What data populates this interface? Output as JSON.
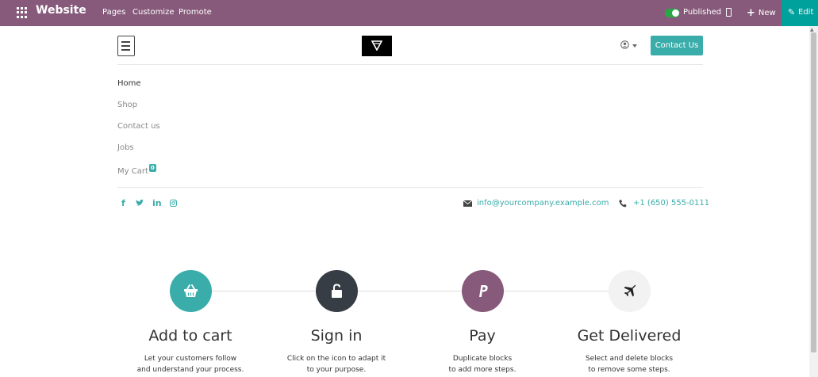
{
  "topbar": {
    "app_name": "Website",
    "menu": [
      "Pages",
      "Customize",
      "Promote"
    ],
    "published_label": "Published",
    "new_label": "New",
    "edit_label": "Edit",
    "color": "#875a7b",
    "edit_color": "#00a09d"
  },
  "header": {
    "contact_button": "Contact Us",
    "accent": "#3aadaa"
  },
  "nav": {
    "items": [
      "Home",
      "Shop",
      "Contact us",
      "Jobs",
      "My Cart"
    ],
    "cart_count": "0"
  },
  "contact": {
    "email": "info@yourcompany.example.com",
    "phone": "+1 (650) 555-0111",
    "social_icons": [
      "facebook-icon",
      "twitter-icon",
      "linkedin-icon",
      "instagram-icon"
    ]
  },
  "steps": [
    {
      "title": "Add to cart",
      "desc1": "Let your customers follow",
      "desc2": "and understand your process.",
      "icon": "basket-icon",
      "color": "#3aadaa"
    },
    {
      "title": "Sign in",
      "desc1": "Click on the icon to adapt it",
      "desc2": "to your purpose.",
      "icon": "unlock-icon",
      "color": "#373d44"
    },
    {
      "title": "Pay",
      "desc1": "Duplicate blocks",
      "desc2": "to add more steps.",
      "icon": "paypal-icon",
      "color": "#875a7b"
    },
    {
      "title": "Get Delivered",
      "desc1": "Select and delete blocks",
      "desc2": "to remove some steps.",
      "icon": "plane-icon",
      "color": "#f2f2f2"
    }
  ]
}
